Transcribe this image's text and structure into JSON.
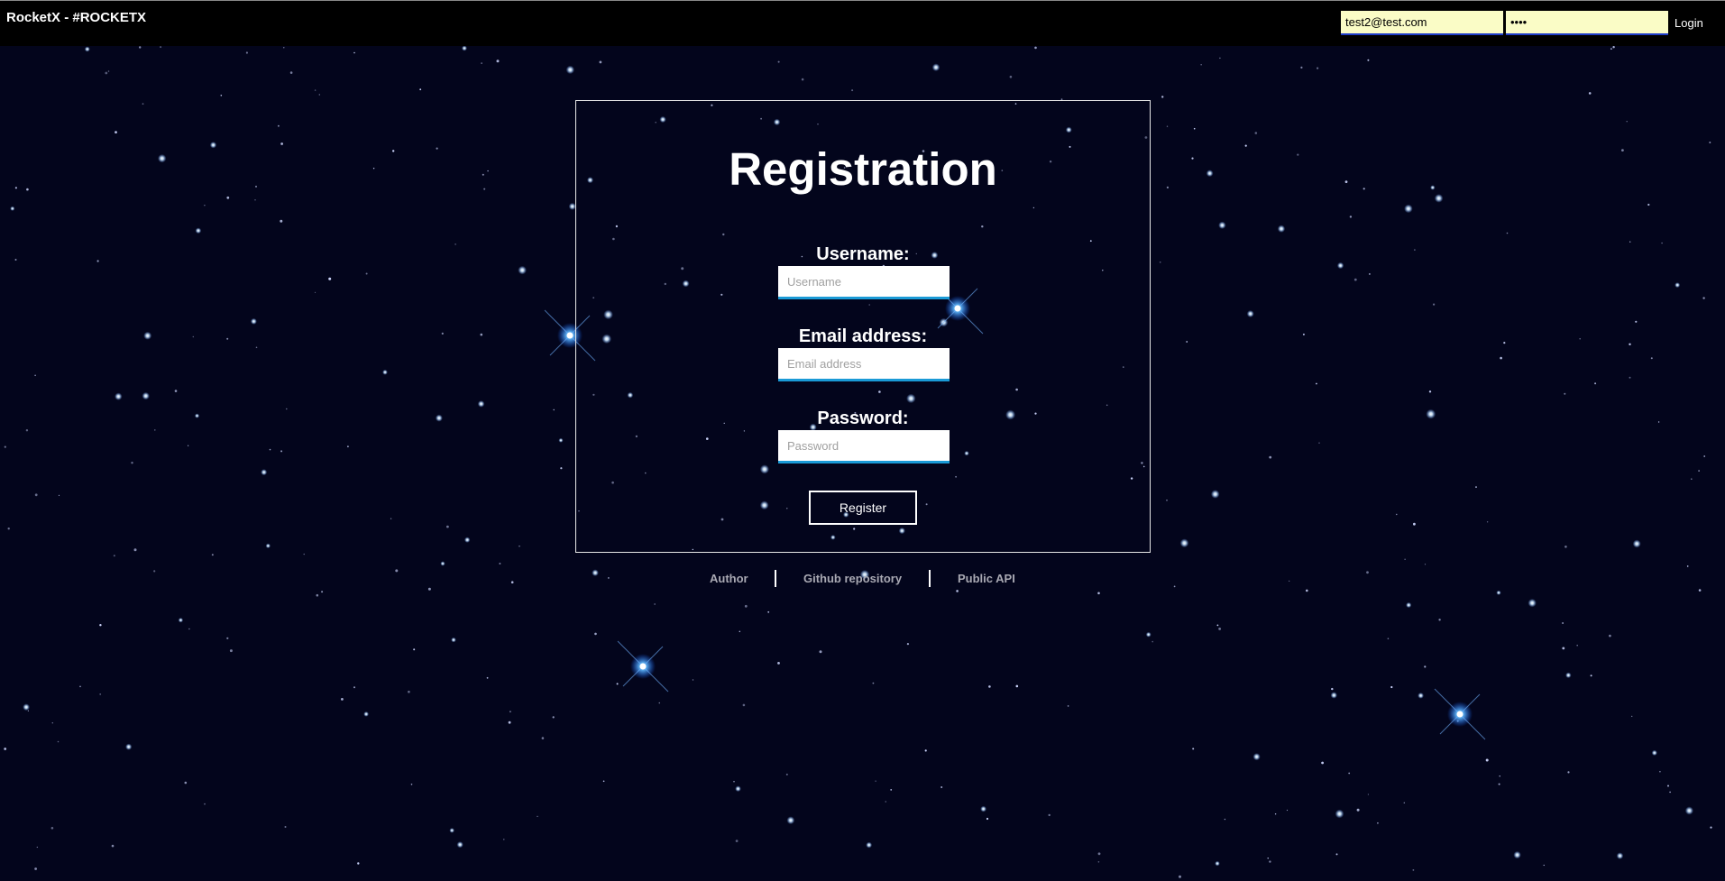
{
  "navbar": {
    "brand": "RocketX - #ROCKETX",
    "login_email_value": "test2@test.com",
    "login_password_value": "test",
    "login_label": "Login"
  },
  "registration": {
    "title": "Registration",
    "username_label": "Username:",
    "username_placeholder": "Username",
    "email_label": "Email address:",
    "email_placeholder": "Email address",
    "password_label": "Password:",
    "password_placeholder": "Password",
    "register_label": "Register"
  },
  "footer": {
    "author": "Author",
    "github": "Github repository",
    "api": "Public API"
  },
  "colors": {
    "background": "#03051c",
    "input_accent": "#1a9ad6",
    "login_input_bg": "#fafcc6",
    "login_input_accent": "#1e3cc8"
  }
}
